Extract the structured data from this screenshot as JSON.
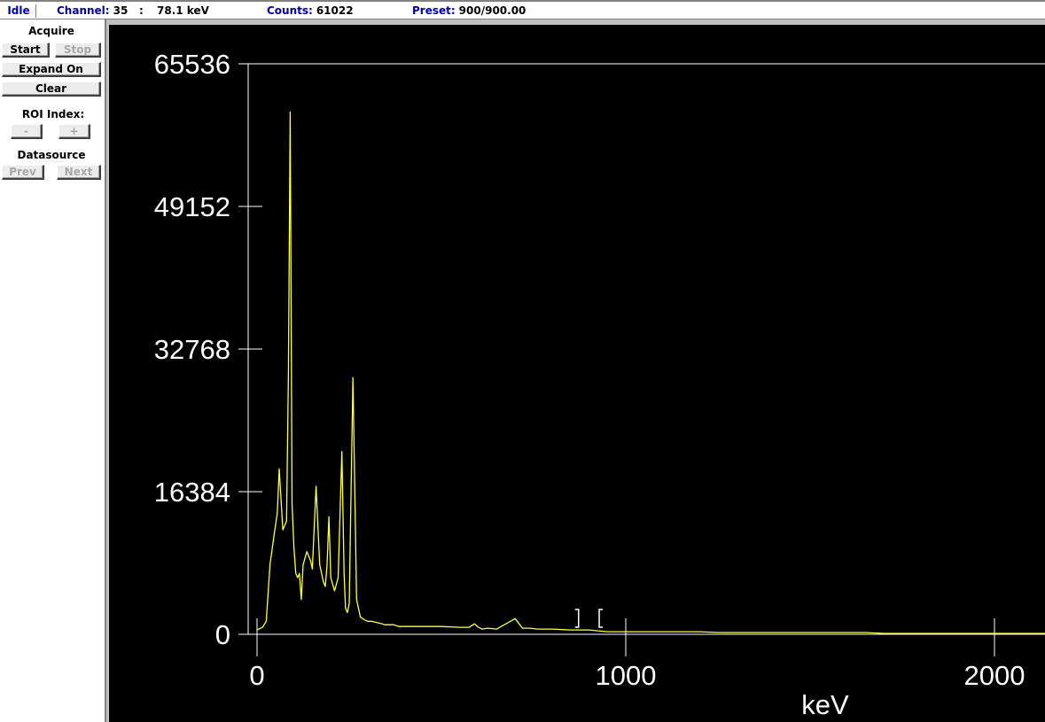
{
  "status": {
    "state": "Idle",
    "channel_label": "Channel:",
    "channel_value": "35",
    "separator": ":",
    "energy_value": "78.1 keV",
    "counts_label": "Counts:",
    "counts_value": "61022",
    "preset_label": "Preset:",
    "preset_value": "900/900.00"
  },
  "panel": {
    "acquire_title": "Acquire",
    "start": "Start",
    "stop": "Stop",
    "expand": "Expand On",
    "clear": "Clear",
    "roi_title": "ROI Index:",
    "roi_minus": "-",
    "roi_plus": "+",
    "datasource_title": "Datasource",
    "prev": "Prev",
    "next": "Next"
  },
  "colors": {
    "plot_background": "#000000",
    "spectrum_line": "#ffff40",
    "axes": "#ffffff",
    "status_label": "#0000a0",
    "disabled_text": "#a8a8a8"
  },
  "chart_data": {
    "type": "line",
    "title": "",
    "xlabel": "keV",
    "ylabel": "",
    "xlim": [
      0,
      2150
    ],
    "ylim": [
      0,
      65536
    ],
    "yticks": [
      0,
      16384,
      32768,
      49152,
      65536
    ],
    "xticks": [
      0,
      1000,
      2000
    ],
    "grid": false,
    "roi_markers": [
      {
        "type": "]",
        "x": 872
      },
      {
        "type": "[",
        "x": 928
      }
    ],
    "series": [
      {
        "x": [
          0,
          15,
          25,
          35,
          45,
          55,
          60,
          70,
          80,
          85,
          90,
          95,
          100,
          105,
          110,
          115,
          120,
          125,
          135,
          140,
          145,
          150,
          160,
          170,
          180,
          185,
          190,
          195,
          200,
          210,
          220,
          230,
          236,
          240,
          245,
          250,
          260,
          270,
          280,
          290,
          295,
          300,
          305,
          310,
          320,
          330,
          340,
          345,
          350,
          355,
          360,
          370,
          385,
          400,
          450,
          500,
          550,
          575,
          590,
          600,
          610,
          625,
          650,
          700,
          720,
          740,
          760,
          780,
          800,
          850,
          900,
          950,
          1000,
          1050,
          1080,
          1100,
          1120,
          1150,
          1200,
          1250,
          1300,
          1350,
          1400,
          1450,
          1500,
          1550,
          1600,
          1650,
          1700,
          1720,
          1750,
          1780,
          1800,
          1850,
          1900,
          2000,
          2050,
          2100,
          2150
        ],
        "y": [
          500,
          800,
          1500,
          8000,
          11000,
          14000,
          19000,
          12000,
          13000,
          30000,
          60000,
          15000,
          10000,
          7000,
          6500,
          7000,
          4000,
          8000,
          9500,
          9000,
          8500,
          7500,
          17000,
          8000,
          6000,
          5500,
          8000,
          13500,
          6500,
          5000,
          6500,
          21000,
          7000,
          3000,
          2500,
          3500,
          29500,
          4000,
          2000,
          1700,
          1600,
          1500,
          1500,
          1500,
          1400,
          1300,
          1200,
          1100,
          1100,
          1100,
          1100,
          1100,
          900,
          900,
          900,
          900,
          800,
          800,
          1200,
          800,
          600,
          700,
          600,
          1800,
          700,
          700,
          600,
          600,
          600,
          500,
          500,
          300,
          300,
          300,
          300,
          300,
          300,
          300,
          300,
          200,
          200,
          200,
          200,
          200,
          200,
          200,
          200,
          200,
          100,
          100,
          100,
          100,
          100,
          100,
          100,
          100,
          100,
          100,
          100
        ]
      }
    ]
  }
}
